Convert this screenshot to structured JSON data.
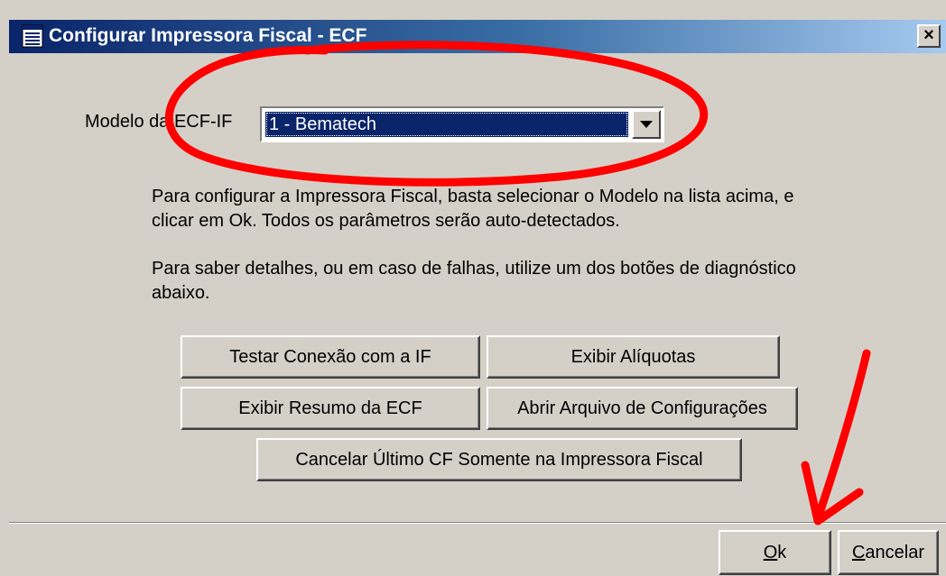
{
  "window": {
    "title": "Configurar Impressora Fiscal - ECF",
    "title_icon": "form-icon",
    "close_label": "×"
  },
  "form": {
    "modelo_label": "Modelo da ECF-IF",
    "modelo_selected": "1 - Bematech",
    "dropdown_icon": "chevron-down-icon"
  },
  "instructions": {
    "paragraph1": "Para configurar a Impressora Fiscal, basta selecionar o Modelo na lista acima, e clicar em Ok. Todos os parâmetros serão auto-detectados.",
    "paragraph2": "Para saber detalhes, ou em caso de falhas, utilize um dos botões de diagnóstico abaixo."
  },
  "diagnostics": {
    "test_connection": "Testar Conexão com a IF",
    "show_rates": "Exibir Alíquotas",
    "show_summary": "Exibir Resumo da ECF",
    "open_config": "Abrir Arquivo de Configurações",
    "cancel_last_cf": "Cancelar Último CF Somente na Impressora Fiscal"
  },
  "footer": {
    "ok_accel": "O",
    "ok_rest": "k",
    "cancel_accel": "C",
    "cancel_rest": "ancelar"
  },
  "annotations": {
    "highlight_color": "#ff0000"
  }
}
